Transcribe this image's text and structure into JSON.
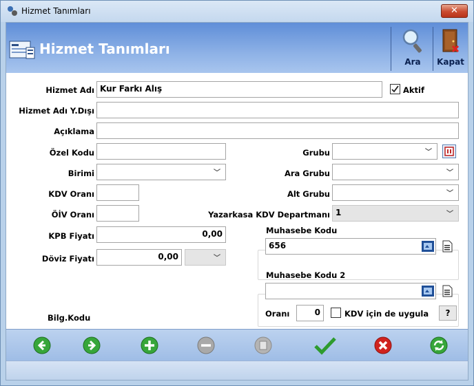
{
  "window": {
    "title": "Hizmet Tanımları",
    "close_label": "✕"
  },
  "banner": {
    "title": "Hizmet Tanımları",
    "search_label": "Ara",
    "close_label": "Kapat"
  },
  "form": {
    "name_label": "Hizmet Adı",
    "name_value": "Kur Farkı Alış",
    "active_label": "Aktif",
    "active_checked": true,
    "foreign_name_label": "Hizmet Adı Y.Dışı",
    "foreign_name_value": "",
    "description_label": "Açıklama",
    "description_value": "",
    "special_code_label": "Özel Kodu",
    "special_code_value": "",
    "unit_label": "Birimi",
    "unit_value": "",
    "vat_rate_label": "KDV Oranı",
    "vat_rate_value": "",
    "oiv_rate_label": "ÖİV Oranı",
    "oiv_rate_value": "",
    "kpb_price_label": "KPB Fiyatı",
    "kpb_price_value": "0,00",
    "fx_price_label": "Döviz Fiyatı",
    "fx_price_value": "0,00",
    "fx_currency_value": "",
    "group_label": "Grubu",
    "group_value": "",
    "mid_group_label": "Ara Grubu",
    "mid_group_value": "",
    "sub_group_label": "Alt Grubu",
    "sub_group_value": "",
    "cash_register_label": "Yazarkasa KDV Departmanı",
    "cash_register_value": "1",
    "info_code_label": "Bilg.Kodu"
  },
  "accounting": {
    "title": "Muhasebe Kodu",
    "value": "656"
  },
  "accounting2": {
    "title": "Muhasebe Kodu 2",
    "value": "",
    "rate_label": "Oranı",
    "rate_value": "0",
    "vat_apply_label": "KDV için de uygula",
    "vat_apply_checked": false,
    "help_label": "?"
  },
  "navbar": {
    "items": [
      "previous-icon",
      "next-icon",
      "add-icon",
      "remove-icon",
      "delete-icon",
      "save-icon",
      "cancel-icon",
      "refresh-icon"
    ]
  },
  "colors": {
    "accent": "#5f8ed8",
    "green": "#2e9b2e",
    "red": "#d0231f"
  }
}
